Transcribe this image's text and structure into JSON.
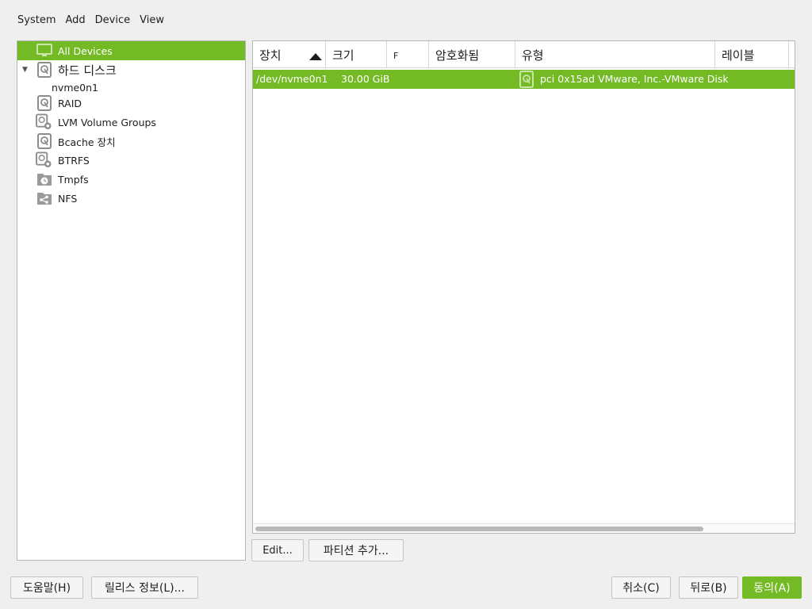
{
  "menu": {
    "items": [
      "System",
      "Add",
      "Device",
      "View"
    ]
  },
  "tree": {
    "items": [
      {
        "label": "All Devices",
        "icon": "monitor-icon",
        "selected": true
      },
      {
        "label": "하드 디스크",
        "icon": "hard-disk-icon",
        "expanded": true
      },
      {
        "label": "nvme0n1",
        "icon": ""
      },
      {
        "label": "RAID",
        "icon": "raid-icon"
      },
      {
        "label": "LVM Volume Groups",
        "icon": "lvm-icon"
      },
      {
        "label": "Bcache 장치",
        "icon": "bcache-icon"
      },
      {
        "label": "BTRFS",
        "icon": "btrfs-icon"
      },
      {
        "label": "Tmpfs",
        "icon": "tmpfs-icon"
      },
      {
        "label": "NFS",
        "icon": "nfs-share-icon"
      }
    ]
  },
  "table": {
    "columns": [
      "장치",
      "크기",
      "F",
      "암호화됨",
      "유형",
      "레이블"
    ],
    "sort_column": "장치",
    "rows": [
      {
        "device": "/dev/nvme0n1",
        "size": "30.00 GiB",
        "f": "",
        "encrypted": "",
        "type": "pci 0x15ad VMware, Inc.-VMware Disk",
        "label": ""
      }
    ]
  },
  "actions": {
    "edit": "Edit...",
    "add_partition": "파티션 추가..."
  },
  "footer": {
    "help": "도움말(H)",
    "release_notes": "릴리스 정보(L)...",
    "cancel": "취소(C)",
    "back": "뒤로(B)",
    "accept": "동의(A)"
  },
  "colors": {
    "accent": "#73ba25",
    "background": "#efefef"
  }
}
